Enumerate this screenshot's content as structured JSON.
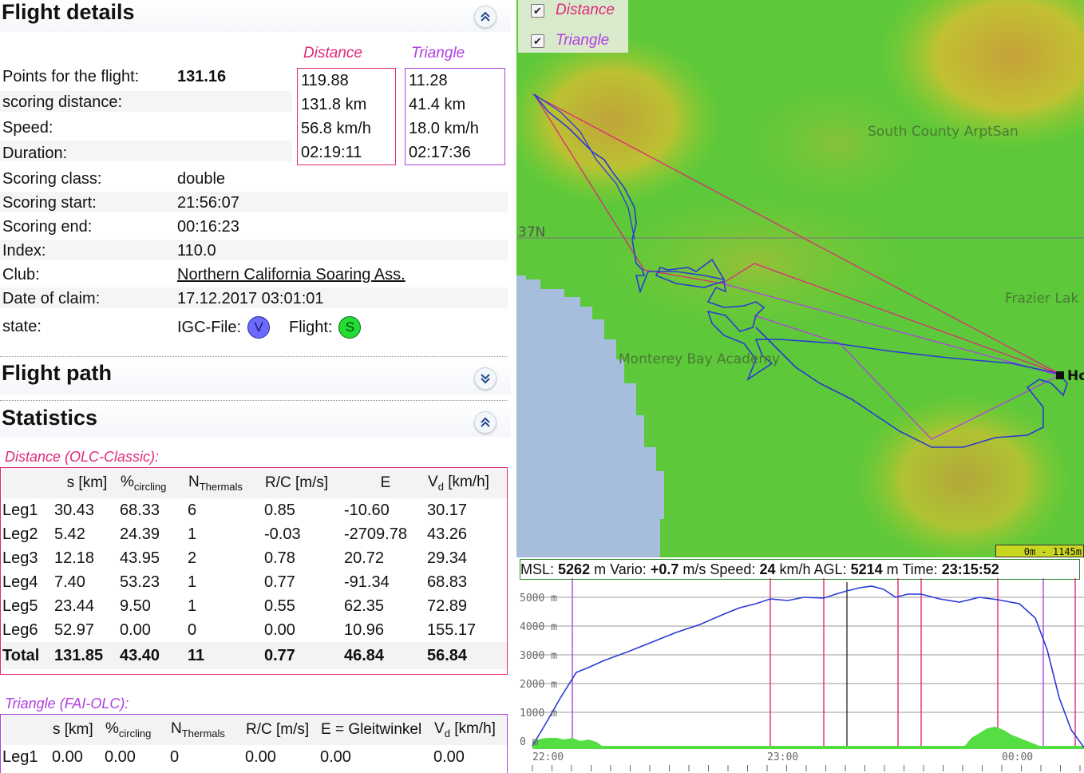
{
  "flight_details": {
    "title": "Flight details",
    "distance_header": "Distance",
    "triangle_header": "Triangle",
    "rows": [
      {
        "label": "Points for the flight:",
        "value": "131.16"
      },
      {
        "label": "scoring distance:",
        "value": ""
      },
      {
        "label": "Speed:",
        "value": ""
      },
      {
        "label": "Duration:",
        "value": ""
      },
      {
        "label": "Scoring class:",
        "value": "double"
      },
      {
        "label": "Scoring start:",
        "value": "21:56:07"
      },
      {
        "label": "Scoring end:",
        "value": "00:16:23"
      },
      {
        "label": "Index:",
        "value": "110.0"
      },
      {
        "label": "Club:",
        "value": "Northern California Soaring Ass."
      },
      {
        "label": "Date of claim:",
        "value": "17.12.2017 03:01:01"
      },
      {
        "label": "state:",
        "value": ""
      }
    ],
    "distance_values": [
      "119.88",
      "131.8 km",
      "56.8 km/h",
      "02:19:11"
    ],
    "triangle_values": [
      "11.28",
      "41.4 km",
      "18.0 km/h",
      "02:17:36"
    ],
    "state": {
      "igc_label": "IGC-File:",
      "igc_icon": "V",
      "flight_label": "Flight:",
      "flight_icon": "S"
    }
  },
  "flight_path": {
    "title": "Flight path"
  },
  "statistics": {
    "title": "Statistics",
    "distance_caption": "Distance (OLC-Classic):",
    "triangle_caption": "Triangle (FAI-OLC):",
    "headers": {
      "s": "s [km]",
      "circ_main": "%",
      "circ_sub": "circling",
      "nth_main": "N",
      "nth_sub": "Thermals",
      "rc": "R/C [m/s]",
      "e": "E",
      "e_tri": "E = Gleitwinkel",
      "vd_main": "V",
      "vd_sub": "d",
      "vd_unit": " [km/h]"
    },
    "distance_rows": [
      [
        "Leg1",
        "30.43",
        "68.33",
        "6",
        "0.85",
        "-10.60",
        "30.17"
      ],
      [
        "Leg2",
        "5.42",
        "24.39",
        "1",
        "-0.03",
        "-2709.78",
        "43.26"
      ],
      [
        "Leg3",
        "12.18",
        "43.95",
        "2",
        "0.78",
        "20.72",
        "29.34"
      ],
      [
        "Leg4",
        "7.40",
        "53.23",
        "1",
        "0.77",
        "-91.34",
        "68.83"
      ],
      [
        "Leg5",
        "23.44",
        "9.50",
        "1",
        "0.55",
        "62.35",
        "72.89"
      ],
      [
        "Leg6",
        "52.97",
        "0.00",
        "0",
        "0.00",
        "10.96",
        "155.17"
      ]
    ],
    "distance_total": [
      "Total",
      "131.85",
      "43.40",
      "11",
      "0.77",
      "46.84",
      "56.84"
    ],
    "triangle_rows": [
      [
        "Leg1",
        "0.00",
        "0.00",
        "0",
        "0.00",
        "0.00",
        "0.00"
      ]
    ]
  },
  "map": {
    "legend": [
      {
        "label": "Distance",
        "checked": true,
        "color": "#e0287a"
      },
      {
        "label": "Triangle",
        "checked": true,
        "color": "#b040e0"
      }
    ],
    "labels": {
      "south_county": "South County ArptSan",
      "frazier": "Frazier Lak",
      "monterey": "Monterey Bay Academy",
      "lat": "37N",
      "home": "Ho"
    },
    "elev_scale": "0m - 1145m"
  },
  "barogram": {
    "msl_label": "MSL:",
    "msl_value": "5262",
    "msl_unit": "m",
    "vario_label": "Vario:",
    "vario_value": "+0.7",
    "vario_unit": "m/s",
    "speed_label": "Speed:",
    "speed_value": "24",
    "speed_unit": "km/h",
    "agl_label": "AGL:",
    "agl_value": "5214",
    "agl_unit": "m",
    "time_label": "Time:",
    "time_value": "23:15:52",
    "y_ticks": [
      "5000 m",
      "4000 m",
      "3000 m",
      "2000 m",
      "1000 m",
      "0 m"
    ],
    "x_ticks": [
      "22:00",
      "23:00",
      "00:00"
    ]
  },
  "colors": {
    "distance": "#e0287a",
    "triangle": "#b040e0",
    "track": "#2a3ad6",
    "water": "#a6bedc"
  }
}
